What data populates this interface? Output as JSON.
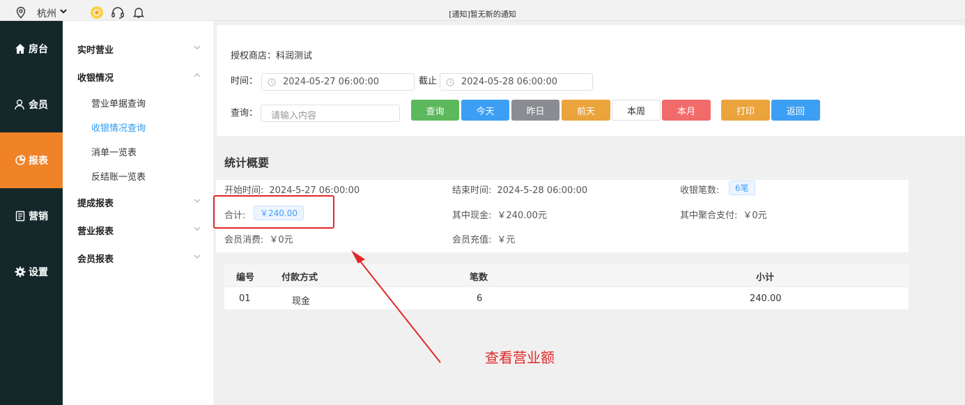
{
  "topbar": {
    "city": "杭州",
    "notice": "[通知]暂无新的通知"
  },
  "leftnav": {
    "items": [
      {
        "label": "房台",
        "icon": "home-icon"
      },
      {
        "label": "会员",
        "icon": "user-icon"
      },
      {
        "label": "报表",
        "icon": "pie-chart-icon",
        "active": true
      },
      {
        "label": "营销",
        "icon": "document-icon"
      },
      {
        "label": "设置",
        "icon": "gear-icon"
      }
    ]
  },
  "submenu": {
    "groups": [
      {
        "label": "实时营业"
      },
      {
        "label": "收银情况",
        "children": [
          "营业单据查询",
          "收银情况查询",
          "消单一览表",
          "反结账一览表"
        ]
      },
      {
        "label": "提成报表"
      },
      {
        "label": "营业报表"
      },
      {
        "label": "会员报表"
      }
    ],
    "active_child": "收银情况查询"
  },
  "filter": {
    "shop": "授权商店：科润测试",
    "time_label": "时间：",
    "start": "2024-05-27 06:00:00",
    "until_label": "截止",
    "end": "2024-05-28 06:00:00",
    "query_label": "查询：",
    "search_placeholder": "请输入内容",
    "buttons": [
      {
        "label": "查询",
        "color": "#5cb85c"
      },
      {
        "label": "今天",
        "color": "#3d9ff3"
      },
      {
        "label": "昨日",
        "color": "#8a8c91"
      },
      {
        "label": "前天",
        "color": "#eba33c"
      },
      {
        "label": "本周",
        "color": "#ffffff"
      },
      {
        "label": "本月",
        "color": "#f26b6b"
      },
      {
        "label": "打印",
        "color": "#eba33c"
      },
      {
        "label": "返回",
        "color": "#3d9ff3"
      }
    ]
  },
  "summary": {
    "title": "统计概要",
    "start_label": "开始时间:",
    "start_value": "2024-5-27 06:00:00",
    "end_label": "结束时间:",
    "end_value": "2024-5-28 06:00:00",
    "count_label": "收银笔数:",
    "count_value": "6笔",
    "total_label": "合计:",
    "total_value": "￥240.00",
    "cash_label": "其中现金:",
    "cash_value": "￥240.00元",
    "agg_label": "其中聚合支付:",
    "agg_value": "￥0元",
    "member_spend_label": "会员消费:",
    "member_spend_value": "￥0元",
    "member_recharge_label": "会员充值:",
    "member_recharge_value": "￥元"
  },
  "table": {
    "headers": [
      "编号",
      "付款方式",
      "笔数",
      "小计"
    ],
    "rows": [
      [
        "01",
        "现金",
        "6",
        "240.00"
      ]
    ]
  },
  "annotation": {
    "text": "查看营业额",
    "color": "#e02828"
  }
}
